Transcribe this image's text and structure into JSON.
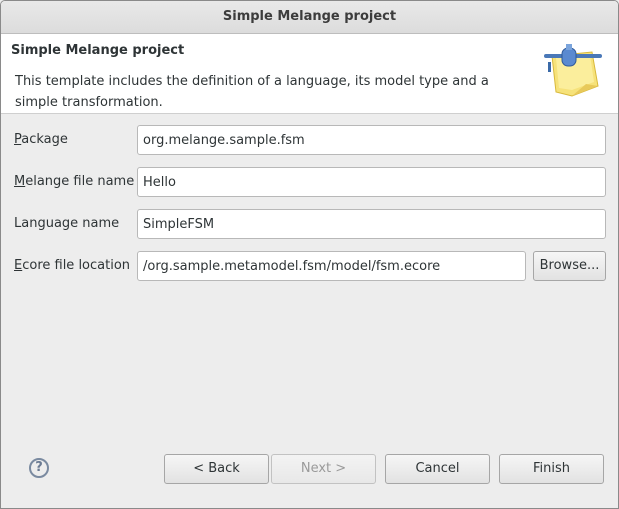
{
  "window": {
    "title": "Simple Melange project"
  },
  "banner": {
    "title": "Simple Melange project",
    "description": "This template includes the definition of a language, its model type and a simple transformation.",
    "icon": "plugin-plug-icon"
  },
  "form": {
    "package": {
      "mnemonic": "P",
      "label_rest": "ackage",
      "value": "org.melange.sample.fsm"
    },
    "melange_file_name": {
      "mnemonic": "M",
      "label_rest": "elange file name",
      "value": "Hello"
    },
    "language_name": {
      "label": "Language name",
      "value": "SimpleFSM"
    },
    "ecore_file_location": {
      "mnemonic": "E",
      "label_rest": "core file location",
      "value": "/org.sample.metamodel.fsm/model/fsm.ecore"
    },
    "browse_label": "Browse..."
  },
  "footer": {
    "help_glyph": "?",
    "back_label": "< Back",
    "next_label": "Next >",
    "cancel_label": "Cancel",
    "finish_label": "Finish"
  }
}
